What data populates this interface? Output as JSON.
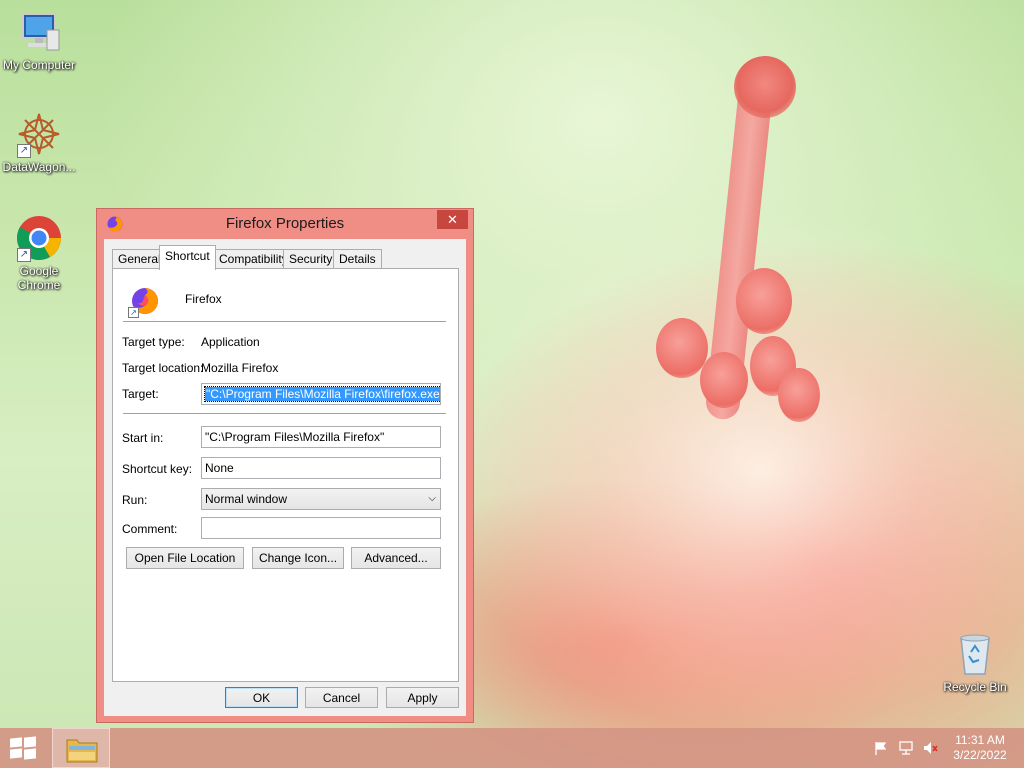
{
  "desktop": {
    "icons": [
      {
        "label": "My Computer",
        "icon": "computer-icon"
      },
      {
        "label": "DataWagon...",
        "icon": "datawagon-icon"
      },
      {
        "label": "Google Chrome",
        "icon": "chrome-icon"
      },
      {
        "label": "Recycle Bin",
        "icon": "recycle-bin-icon"
      }
    ]
  },
  "window": {
    "title": "Firefox Properties",
    "close_label": "✕",
    "tabs": [
      {
        "label": "General"
      },
      {
        "label": "Shortcut",
        "active": true
      },
      {
        "label": "Compatibility"
      },
      {
        "label": "Security"
      },
      {
        "label": "Details"
      }
    ],
    "shortcut": {
      "name": "Firefox",
      "target_type_label": "Target type:",
      "target_type_value": "Application",
      "target_location_label": "Target location:",
      "target_location_value": "Mozilla Firefox",
      "target_label": "Target:",
      "target_value": "\"C:\\Program Files\\Mozilla Firefox\\firefox.exe\"",
      "start_in_label": "Start in:",
      "start_in_value": "\"C:\\Program Files\\Mozilla Firefox\"",
      "shortcut_key_label": "Shortcut key:",
      "shortcut_key_value": "None",
      "run_label": "Run:",
      "run_value": "Normal window",
      "comment_label": "Comment:",
      "comment_value": "",
      "open_file_location": "Open File Location",
      "change_icon": "Change Icon...",
      "advanced": "Advanced..."
    },
    "buttons": {
      "ok": "OK",
      "cancel": "Cancel",
      "apply": "Apply"
    }
  },
  "taskbar": {
    "time": "11:31 AM",
    "date": "3/22/2022",
    "colors": {
      "window_frame": "#f08d84",
      "selection": "#3399ff"
    }
  }
}
